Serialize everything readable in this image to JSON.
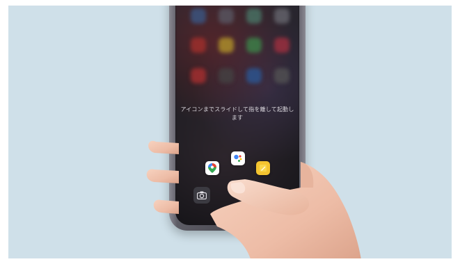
{
  "overlay_text": {
    "hint": "アイコンまでスライドして指を離して起動します"
  },
  "icons": {
    "maps": "google-maps-icon",
    "assistant": "google-assistant-icon",
    "notes": "notes-icon",
    "camera": "camera-icon"
  },
  "colors": {
    "background": "#cfe0e9",
    "phone_frame": "#4a4951",
    "screen": "#16151a"
  }
}
